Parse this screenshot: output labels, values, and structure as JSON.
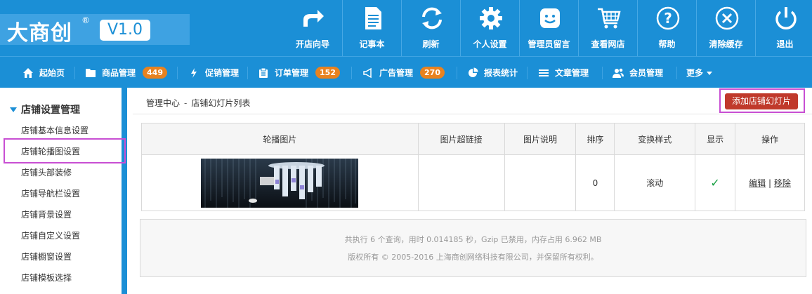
{
  "logo": {
    "text": "大商创",
    "reg": "®",
    "version": "V1.0"
  },
  "toolbar": [
    {
      "label": "开店向导",
      "icon": "share-arrow-icon"
    },
    {
      "label": "记事本",
      "icon": "notepad-icon"
    },
    {
      "label": "刷新",
      "icon": "refresh-icon"
    },
    {
      "label": "个人设置",
      "icon": "gear-icon"
    },
    {
      "label": "管理员留言",
      "icon": "smiley-message-icon"
    },
    {
      "label": "查看网店",
      "icon": "cart-icon"
    },
    {
      "label": "帮助",
      "icon": "help-icon"
    },
    {
      "label": "清除缓存",
      "icon": "close-circle-icon"
    },
    {
      "label": "退出",
      "icon": "power-icon"
    }
  ],
  "nav": [
    {
      "label": "起始页",
      "icon": "home-icon"
    },
    {
      "label": "商品管理",
      "icon": "folder-icon",
      "badge": "449"
    },
    {
      "label": "促销管理",
      "icon": "lightning-icon"
    },
    {
      "label": "订单管理",
      "icon": "clipboard-icon",
      "badge": "152"
    },
    {
      "label": "广告管理",
      "icon": "megaphone-icon",
      "badge": "270"
    },
    {
      "label": "报表统计",
      "icon": "pie-chart-icon"
    },
    {
      "label": "文章管理",
      "icon": "list-icon"
    },
    {
      "label": "会员管理",
      "icon": "users-icon"
    },
    {
      "label": "更多"
    }
  ],
  "sidebar": {
    "title": "店铺设置管理",
    "items": [
      "店铺基本信息设置",
      "店铺轮播图设置",
      "店铺头部装修",
      "店铺导航栏设置",
      "店铺背景设置",
      "店铺自定义设置",
      "店铺橱窗设置",
      "店铺模板选择"
    ]
  },
  "breadcrumb": {
    "home": "管理中心",
    "sep": "-",
    "current": "店铺幻灯片列表"
  },
  "add_button": "添加店铺幻灯片",
  "table": {
    "headers": [
      "轮播图片",
      "图片超链接",
      "图片说明",
      "排序",
      "变换样式",
      "显示",
      "操作"
    ],
    "rows": [
      {
        "link": "",
        "desc": "",
        "order": "0",
        "effect": "滚动",
        "show": "✓",
        "edit": "编辑",
        "sep": "|",
        "remove": "移除"
      }
    ]
  },
  "footer": {
    "stats": "共执行 6 个查询，用时 0.014185 秒，Gzip 已禁用，内存占用 6.962 MB",
    "copyright": "版权所有 © 2005-2016 上海商创网络科技有限公司，并保留所有权利。"
  },
  "colors": {
    "primary": "#1b8fd6",
    "badge": "#e8821f",
    "add_button": "#c0392b",
    "highlight": "#c84fd3",
    "check": "#18a043"
  }
}
